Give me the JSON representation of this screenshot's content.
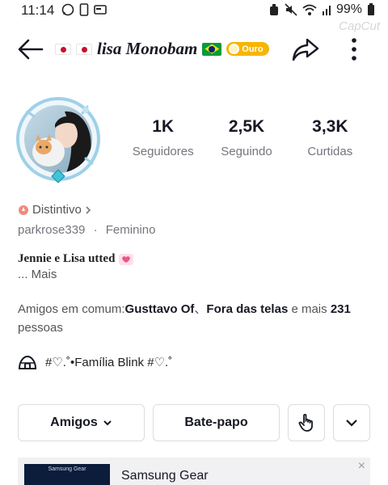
{
  "status_bar": {
    "time": "11:14",
    "battery": "99%"
  },
  "watermark": "CapCut",
  "header": {
    "username": "lisa Monobam",
    "badge_label": "Ouro"
  },
  "stats": [
    {
      "value": "1K",
      "label": "Seguidores"
    },
    {
      "value": "2,5K",
      "label": "Seguindo"
    },
    {
      "value": "3,3K",
      "label": "Curtidas"
    }
  ],
  "profile": {
    "distintivo_label": "Distintivo",
    "handle": "parkrose339",
    "separator": "·",
    "gender": "Feminino",
    "bio": "Jennie e Lisa utted",
    "more_label": "... Mais"
  },
  "mutual_friends": {
    "prefix": "Amigos em comum:",
    "friend1": "Gusttavo Of",
    "sep": "、",
    "friend2": "Fora das telas",
    "middle": " e mais ",
    "count": "231",
    "suffix": "pessoas"
  },
  "family_label": "#♡.˚•Família Blink #♡.˚",
  "actions": {
    "friends_label": "Amigos",
    "chat_label": "Bate-papo"
  },
  "ad": {
    "thumb_text": "Samsung Gear",
    "title": "Samsung Gear",
    "close": "×"
  },
  "colors": {
    "badge_gold": "#f7b500",
    "avatar_ring": "#9fd0e8",
    "text_primary": "#161823",
    "text_secondary": "#75757d"
  },
  "icons": [
    "back-arrow-icon",
    "share-icon",
    "more-vertical-icon",
    "badge-icon",
    "igloo-icon",
    "chevron-down-icon",
    "close-icon"
  ]
}
